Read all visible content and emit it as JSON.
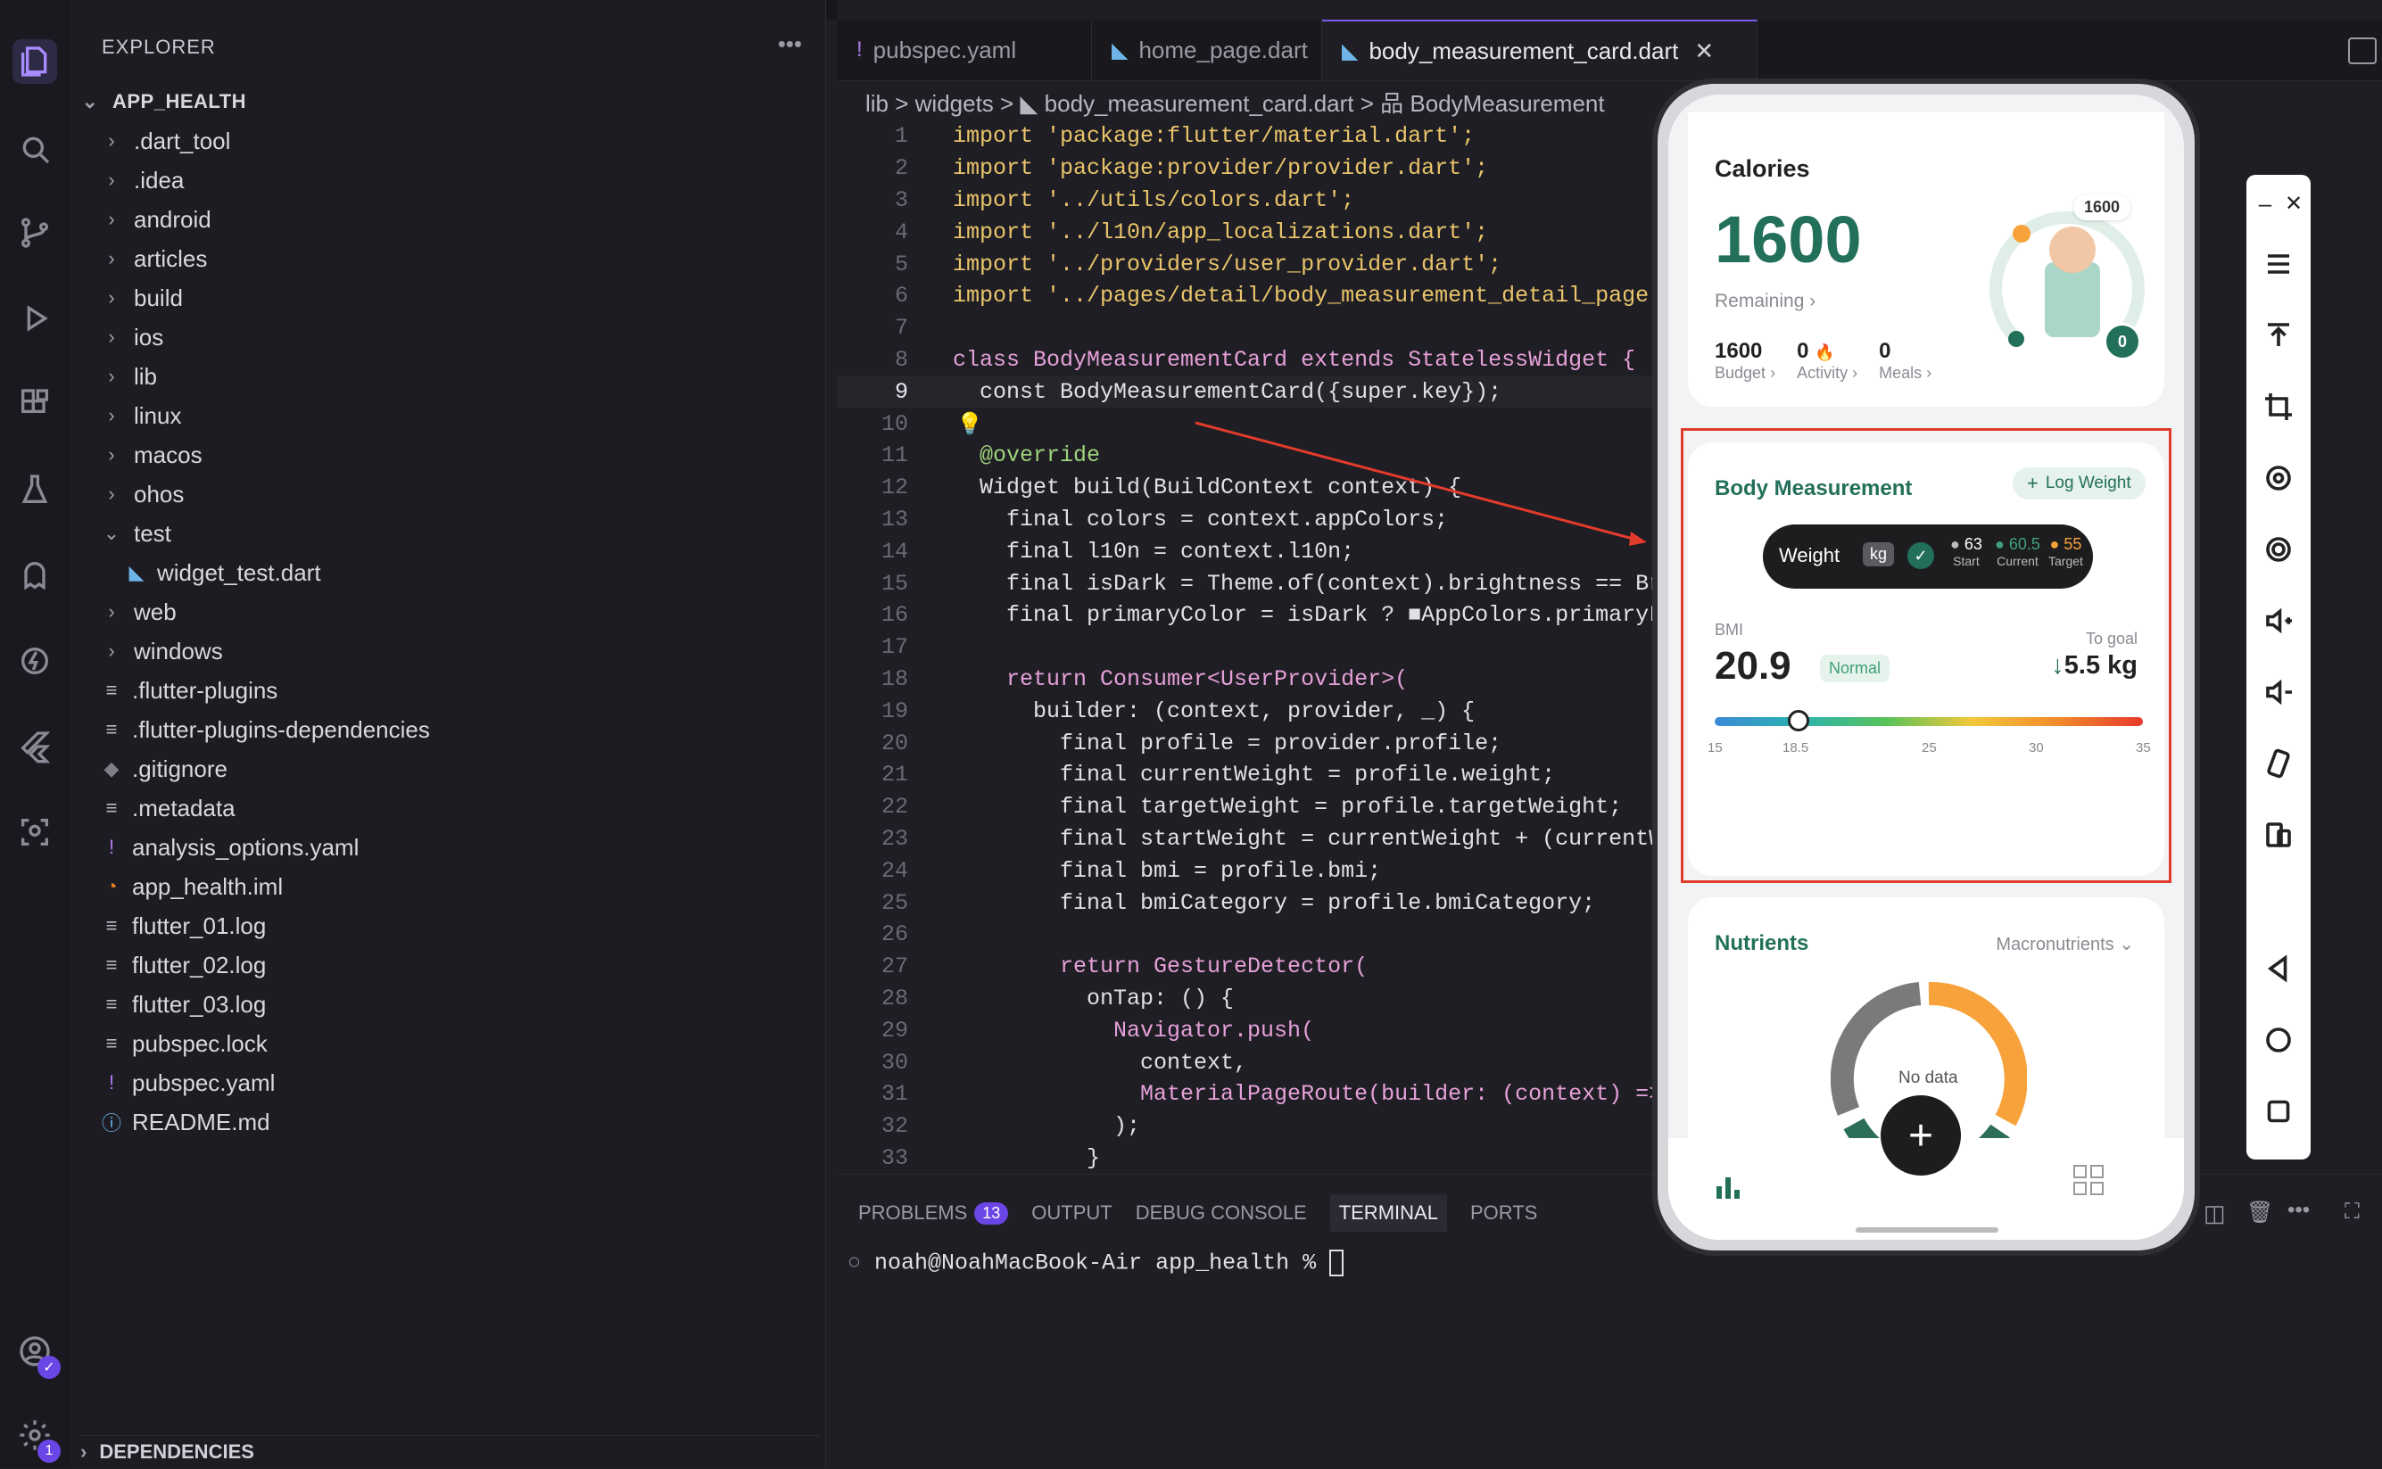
{
  "explorer": {
    "title": "EXPLORER",
    "root": "APP_HEALTH",
    "items": [
      {
        "label": ".dart_tool",
        "kind": "folder"
      },
      {
        "label": ".idea",
        "kind": "folder"
      },
      {
        "label": "android",
        "kind": "folder"
      },
      {
        "label": "articles",
        "kind": "folder"
      },
      {
        "label": "build",
        "kind": "folder"
      },
      {
        "label": "ios",
        "kind": "folder"
      },
      {
        "label": "lib",
        "kind": "folder"
      },
      {
        "label": "linux",
        "kind": "folder"
      },
      {
        "label": "macos",
        "kind": "folder"
      },
      {
        "label": "ohos",
        "kind": "folder"
      },
      {
        "label": "test",
        "kind": "folder-open"
      },
      {
        "label": "widget_test.dart",
        "kind": "dart"
      },
      {
        "label": "web",
        "kind": "folder"
      },
      {
        "label": "windows",
        "kind": "folder"
      },
      {
        "label": ".flutter-plugins",
        "kind": "file"
      },
      {
        "label": ".flutter-plugins-dependencies",
        "kind": "file"
      },
      {
        "label": ".gitignore",
        "kind": "git"
      },
      {
        "label": ".metadata",
        "kind": "file"
      },
      {
        "label": "analysis_options.yaml",
        "kind": "yaml"
      },
      {
        "label": "app_health.iml",
        "kind": "rss"
      },
      {
        "label": "flutter_01.log",
        "kind": "file"
      },
      {
        "label": "flutter_02.log",
        "kind": "file"
      },
      {
        "label": "flutter_03.log",
        "kind": "file"
      },
      {
        "label": "pubspec.lock",
        "kind": "file"
      },
      {
        "label": "pubspec.yaml",
        "kind": "yaml"
      },
      {
        "label": "README.md",
        "kind": "info"
      }
    ],
    "dependencies": "DEPENDENCIES"
  },
  "activity_badge": "1",
  "tabs": [
    {
      "label": "pubspec.yaml",
      "icon": "!"
    },
    {
      "label": "home_page.dart",
      "icon": "◣"
    },
    {
      "label": "body_measurement_card.dart",
      "icon": "◣"
    }
  ],
  "breadcrumb": "lib > widgets > ◣ body_measurement_card.dart > 品 BodyMeasurement",
  "code_lines": [
    {
      "n": "1",
      "text": "import 'package:flutter/material.dart';"
    },
    {
      "n": "2",
      "text": "import 'package:provider/provider.dart';"
    },
    {
      "n": "3",
      "text": "import '../utils/colors.dart';"
    },
    {
      "n": "4",
      "text": "import '../l10n/app_localizations.dart';"
    },
    {
      "n": "5",
      "text": "import '../providers/user_provider.dart';"
    },
    {
      "n": "6",
      "text": "import '../pages/detail/body_measurement_detail_page.d"
    },
    {
      "n": "7",
      "text": ""
    },
    {
      "n": "8",
      "text": "class BodyMeasurementCard extends StatelessWidget {"
    },
    {
      "n": "9",
      "text": "  const BodyMeasurementCard({super.key});"
    },
    {
      "n": "10",
      "text": ""
    },
    {
      "n": "11",
      "text": "  @override"
    },
    {
      "n": "12",
      "text": "  Widget build(BuildContext context) {"
    },
    {
      "n": "13",
      "text": "    final colors = context.appColors;"
    },
    {
      "n": "14",
      "text": "    final l10n = context.l10n;"
    },
    {
      "n": "15",
      "text": "    final isDark = Theme.of(context).brightness == Bri"
    },
    {
      "n": "16",
      "text": "    final primaryColor = isDark ? ■AppColors.primaryL"
    },
    {
      "n": "17",
      "text": ""
    },
    {
      "n": "18",
      "text": "    return Consumer<UserProvider>("
    },
    {
      "n": "19",
      "text": "      builder: (context, provider, _) {"
    },
    {
      "n": "20",
      "text": "        final profile = provider.profile;"
    },
    {
      "n": "21",
      "text": "        final currentWeight = profile.weight;"
    },
    {
      "n": "22",
      "text": "        final targetWeight = profile.targetWeight;"
    },
    {
      "n": "23",
      "text": "        final startWeight = currentWeight + (currentWe"
    },
    {
      "n": "24",
      "text": "        final bmi = profile.bmi;"
    },
    {
      "n": "25",
      "text": "        final bmiCategory = profile.bmiCategory;"
    },
    {
      "n": "26",
      "text": ""
    },
    {
      "n": "27",
      "text": "        return GestureDetector("
    },
    {
      "n": "28",
      "text": "          onTap: () {"
    },
    {
      "n": "29",
      "text": "            Navigator.push("
    },
    {
      "n": "30",
      "text": "              context,"
    },
    {
      "n": "31",
      "text": "              MaterialPageRoute(builder: (context) =>"
    },
    {
      "n": "32",
      "text": "            );"
    },
    {
      "n": "33",
      "text": "          }"
    }
  ],
  "panel": {
    "tabs": [
      "PROBLEMS",
      "OUTPUT",
      "DEBUG CONSOLE",
      "TERMINAL",
      "PORTS"
    ],
    "problems_count": "13",
    "terminal_line": "noah@NoahMacBook-Air app_health % "
  },
  "app": {
    "calories": {
      "title": "Calories",
      "value": "1600",
      "remaining": "Remaining",
      "ring_top": "1600",
      "ring_badge": "0",
      "stats": [
        {
          "value": "1600",
          "label": "Budget"
        },
        {
          "value": "0",
          "label": "Activity"
        },
        {
          "value": "0",
          "label": "Meals"
        }
      ]
    },
    "body": {
      "title": "Body Measurement",
      "log_weight": "Log Weight",
      "weight_label": "Weight",
      "unit": "kg",
      "start_value": "63",
      "start_label": "Start",
      "current_value": "60.5",
      "current_label": "Current",
      "target_value": "55",
      "target_label": "Target",
      "bmi_label": "BMI",
      "bmi_value": "20.9",
      "bmi_status": "Normal",
      "to_goal_label": "To goal",
      "to_goal_value": "5.5 kg",
      "scale": [
        "15",
        "18.5",
        "25",
        "30",
        "35"
      ],
      "bmi_slider": 20.9
    },
    "nutrients": {
      "title": "Nutrients",
      "selector": "Macronutrients",
      "center": "No data"
    },
    "colors": {
      "accent": "#23705a",
      "orange": "#f7a23b",
      "grey": "#7a7a7a",
      "highlight": "#e23b2b"
    }
  }
}
